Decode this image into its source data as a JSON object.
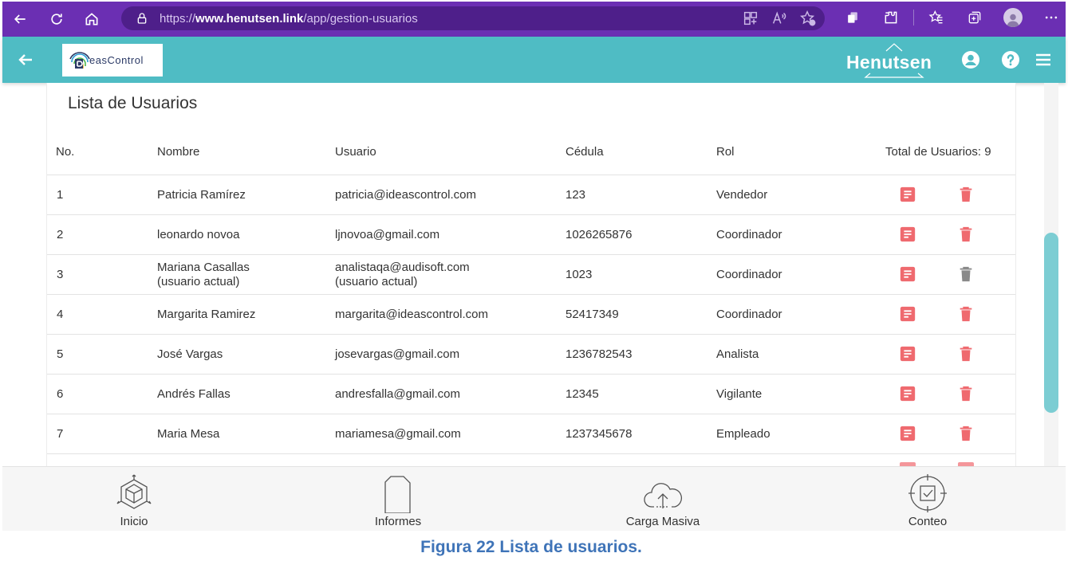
{
  "browser": {
    "url_prefix": "https://",
    "url_host": "www.henutsen.link",
    "url_path": "/app/gestion-usuarios"
  },
  "header": {
    "logo_text": "easControl",
    "brand": "Henutsen"
  },
  "users_list": {
    "title": "Lista de Usuarios",
    "columns": [
      "No.",
      "Nombre",
      "Usuario",
      "Cédula",
      "Rol"
    ],
    "total_label": "Total de Usuarios: 9",
    "rows": [
      {
        "no": "1",
        "name": "Patricia Ramírez",
        "name_note": "",
        "user": "patricia@ideascontrol.com",
        "user_note": "",
        "id": "123",
        "role": "Vendedor"
      },
      {
        "no": "2",
        "name": "leonardo novoa",
        "name_note": "",
        "user": "ljnovoa@gmail.com",
        "user_note": "",
        "id": "1026265876",
        "role": "Coordinador"
      },
      {
        "no": "3",
        "name": "Mariana Casallas",
        "name_note": "(usuario actual)",
        "user": "analistaqa@audisoft.com",
        "user_note": "(usuario actual)",
        "id": "1023",
        "role": "Coordinador"
      },
      {
        "no": "4",
        "name": "Margarita Ramirez",
        "name_note": "",
        "user": "margarita@ideascontrol.com",
        "user_note": "",
        "id": "52417349",
        "role": "Coordinador"
      },
      {
        "no": "5",
        "name": "José Vargas",
        "name_note": "",
        "user": "josevargas@gmail.com",
        "user_note": "",
        "id": "1236782543",
        "role": "Analista"
      },
      {
        "no": "6",
        "name": "Andrés Fallas",
        "name_note": "",
        "user": "andresfalla@gmail.com",
        "user_note": "",
        "id": "12345",
        "role": "Vigilante"
      },
      {
        "no": "7",
        "name": "Maria Mesa",
        "name_note": "",
        "user": "mariamesa@gmail.com",
        "user_note": "",
        "id": "1237345678",
        "role": "Empleado"
      }
    ]
  },
  "bottom_nav": [
    {
      "label": "Inicio",
      "icon": "cube-icon"
    },
    {
      "label": "Informes",
      "icon": "document-icon"
    },
    {
      "label": "Carga Masiva",
      "icon": "cloud-upload-icon"
    },
    {
      "label": "Conteo",
      "icon": "target-check-icon"
    }
  ],
  "caption": "Figura 22 Lista de usuarios.",
  "colors": {
    "browser_bar": "#6b2fb3",
    "app_header": "#4fbcc4",
    "action_red": "#ef6a6f",
    "action_disabled": "#8a8a8a",
    "caption_blue": "#3f74b8"
  }
}
